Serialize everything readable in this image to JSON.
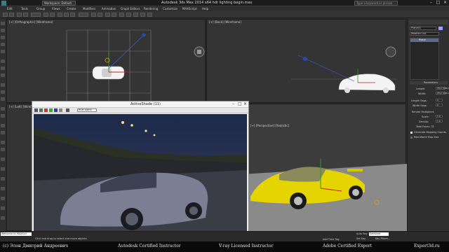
{
  "app": {
    "title": "Autodesk 3ds Max  2014 x64     hdr lighting begin.max",
    "workspace": "Workspace: Default",
    "search_placeholder": "Type a keyword or phrase"
  },
  "menu": [
    "Edit",
    "Tools",
    "Group",
    "Views",
    "Create",
    "Modifiers",
    "Animation",
    "Graph Editors",
    "Rendering",
    "Customize",
    "MAXScript",
    "Help"
  ],
  "viewports": {
    "top_left": "[+] [Orthographic] [Wireframe]",
    "top_right": "[+] [Back] [Wireframe]",
    "bottom_left": "[+] [Left] [Wireframe]",
    "bottom_right": "[+] [Perspective] [Realistic]"
  },
  "activeshade": {
    "title": "ActiveShade (11)",
    "channel": "RGB Alpha"
  },
  "panel": {
    "object_name": "Plane01",
    "modifier_list": "Modifier List",
    "stack_item": "Plane",
    "rollout": "Parameters",
    "length_label": "Length:",
    "length_value": "2517,463cm",
    "width_label": "Width:",
    "width_value": "2517,463cm",
    "length_segs_label": "Length Segs:",
    "length_segs_value": "4",
    "width_segs_label": "Width Segs:",
    "width_segs_value": "4",
    "render_mult": "Render Multipliers",
    "scale_label": "Scale:",
    "scale_value": "1,0",
    "density_label": "Density:",
    "density_value": "1,0",
    "total_faces": "Total Faces: 32",
    "gen_mapping": "Generate Mapping Coords.",
    "real_world": "Real-World Map Size"
  },
  "status": {
    "hint": "Click and drag to select and move objects",
    "welcome": "Welcome to MAXScri",
    "auto_key": "Auto Key",
    "selected": "Selected",
    "set_key": "Set Key",
    "key_filters": "Key Filters...",
    "add_time_tag": "Add Time Tag"
  },
  "footer": {
    "left": "(c) Элон Дмитрий Андреевич",
    "mid": "Autodesk Certified Instructor",
    "vray": "V-ray Licensed Instructor",
    "adobe": "Adobe Certified Expert",
    "site": "Expert3d.ru"
  },
  "colors": {
    "car_yellow": "#e6d400",
    "viewport_bg": "#343434"
  }
}
